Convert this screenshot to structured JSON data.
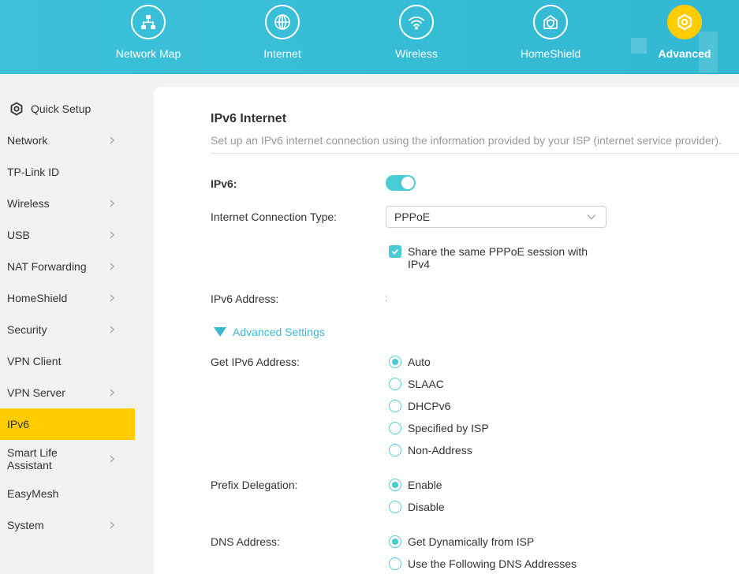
{
  "topnav": {
    "items": [
      {
        "label": "Network Map",
        "icon": "network-map-icon"
      },
      {
        "label": "Internet",
        "icon": "globe-icon"
      },
      {
        "label": "Wireless",
        "icon": "wifi-icon"
      },
      {
        "label": "HomeShield",
        "icon": "homeshield-icon"
      },
      {
        "label": "Advanced",
        "icon": "gear-icon",
        "active": true
      }
    ]
  },
  "sidebar": {
    "items": [
      {
        "label": "Quick Setup"
      },
      {
        "label": "Network"
      },
      {
        "label": "TP-Link ID"
      },
      {
        "label": "Wireless"
      },
      {
        "label": "USB"
      },
      {
        "label": "NAT Forwarding"
      },
      {
        "label": "HomeShield"
      },
      {
        "label": "Security"
      },
      {
        "label": "VPN Client"
      },
      {
        "label": "VPN Server"
      },
      {
        "label": "IPv6",
        "active": true
      },
      {
        "label": "Smart Life Assistant"
      },
      {
        "label": "EasyMesh"
      },
      {
        "label": "System"
      }
    ]
  },
  "main": {
    "title": "IPv6 Internet",
    "subtitle": "Set up an IPv6 internet connection using the information provided by your ISP (internet service provider).",
    "ipv6_label": "IPv6:",
    "ipv6_enabled": true,
    "conn_type_label": "Internet Connection Type:",
    "conn_type_value": "PPPoE",
    "share_session_label": "Share the same PPPoE session with IPv4",
    "share_session_checked": true,
    "address_label": "IPv6 Address:",
    "address_value": ":",
    "advanced_label": "Advanced Settings",
    "get_addr_label": "Get IPv6 Address:",
    "get_addr_options": [
      "Auto",
      "SLAAC",
      "DHCPv6",
      "Specified by ISP",
      "Non-Address"
    ],
    "prefix_label": "Prefix Delegation:",
    "prefix_options": [
      "Enable",
      "Disable"
    ],
    "dns_label": "DNS Address:",
    "dns_options": [
      "Get Dynamically from ISP",
      "Use the Following DNS Addresses"
    ]
  },
  "colors": {
    "accent": "#4acbd6",
    "header": "#3cc1d9",
    "active": "#ffcc00"
  }
}
